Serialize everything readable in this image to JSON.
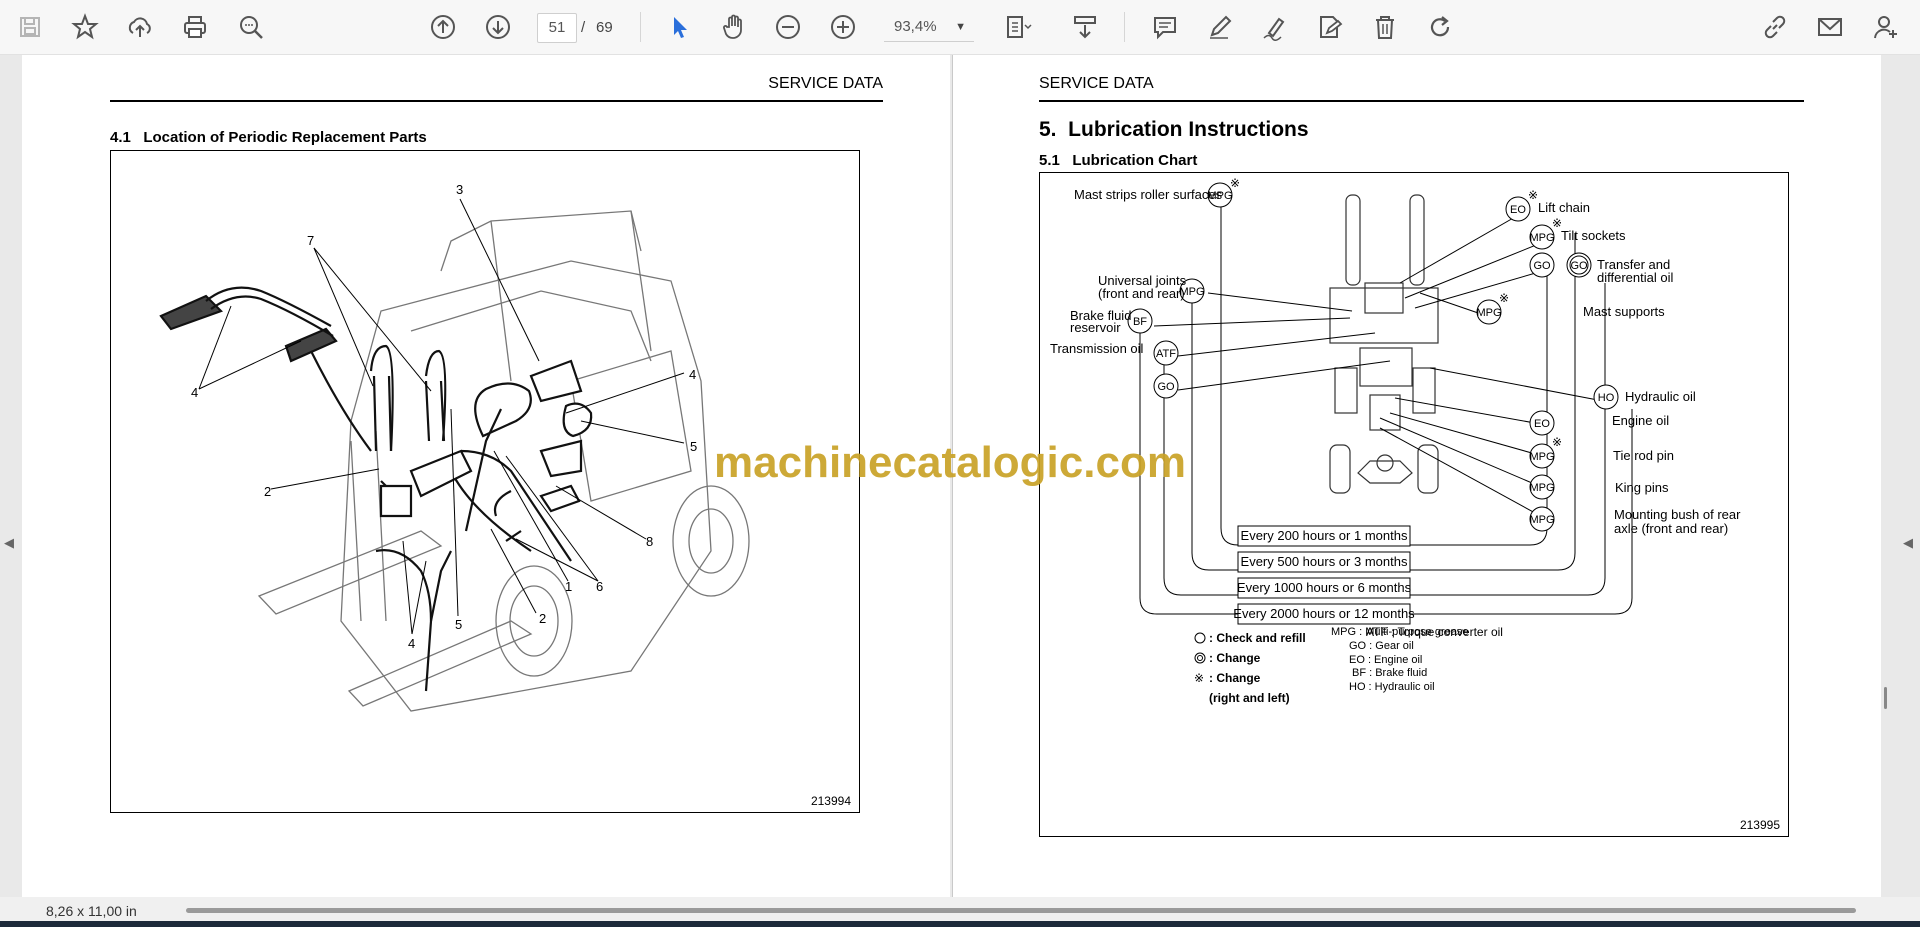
{
  "toolbar": {
    "icons": [
      "save-icon",
      "bookmark-star-icon",
      "upload-icon",
      "print-icon",
      "search-icon",
      "page-up-icon",
      "page-down-icon",
      "select-cursor-icon",
      "hand-tool-icon",
      "zoom-out-icon",
      "zoom-in-icon",
      "fit-page-icon",
      "scroll-mode-icon",
      "comment-icon",
      "pen-icon",
      "signature-icon",
      "edit-doc-icon",
      "delete-icon",
      "redo-icon",
      "link-icon",
      "mail-icon",
      "share-icon"
    ],
    "current_page": "51",
    "page_separator": "/",
    "total_pages": "69",
    "zoom": "93,4%"
  },
  "status": {
    "page_size": "8,26 x 11,00 in"
  },
  "watermark": "machinecatalogic.com",
  "left_page": {
    "header": "SERVICE DATA",
    "section": "4.1   Location of Periodic Replacement Parts",
    "figure_number": "213994",
    "callouts": [
      "3",
      "7",
      "4",
      "4",
      "5",
      "2",
      "8",
      "1",
      "6",
      "2",
      "5",
      "4"
    ]
  },
  "right_page": {
    "header": "SERVICE DATA",
    "title": "5.  Lubrication Instructions",
    "subtitle": "5.1   Lubrication Chart",
    "figure_number": "213995",
    "labels": {
      "mast_strips": "Mast strips roller surfaces",
      "lift_chain": "Lift chain",
      "tilt_sockets": "Tilt sockets",
      "transfer": [
        "Transfer and",
        "differential oil"
      ],
      "universal": [
        "Universal joints",
        "(front and rear)"
      ],
      "mast_supports": "Mast supports",
      "brake": [
        "Brake fluid",
        "reservoir"
      ],
      "transmission": "Transmission oil",
      "hydraulic": "Hydraulic oil",
      "engine": "Engine oil",
      "tie_rod": "Tie rod pin",
      "king_pins": "King pins",
      "mounting": [
        "Mounting bush of rear",
        "axle (front and rear)"
      ]
    },
    "circles": {
      "mpg": "MPG",
      "eo": "EO",
      "go": "GO",
      "bf": "BF",
      "atf": "ATF",
      "ho": "HO"
    },
    "intervals": [
      "Every 200 hours or 1 months",
      "Every 500 hours or 3 months",
      "Every 1000 hours or 6 months",
      "Every 2000 hours or 12 months"
    ],
    "legend_left": [
      ": Check and refill",
      ": Change",
      ": Change",
      "(right and left)"
    ],
    "legend_right": [
      "ATF : Torque converter oil",
      "MPG : Multi-purpose grease",
      "GO : Gear oil",
      "EO : Engine oil",
      "BF : Brake fluid",
      "HO : Hydraulic oil"
    ],
    "mark": "※"
  }
}
